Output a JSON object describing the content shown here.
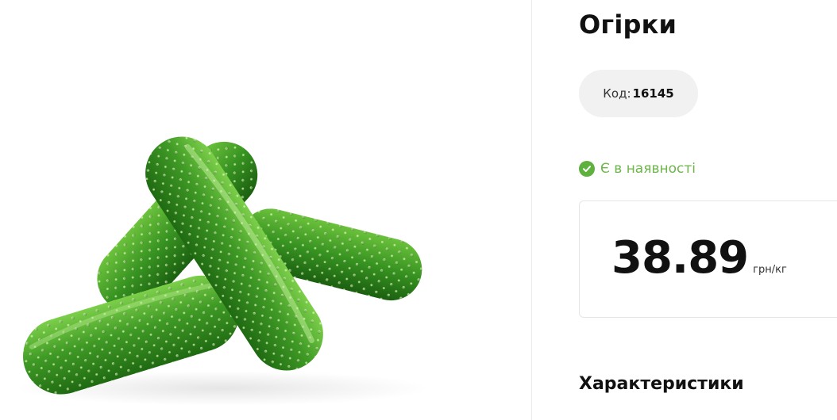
{
  "product": {
    "title": "Огірки",
    "code_label": "Код:",
    "code_value": "16145",
    "availability": "Є в наявності",
    "price": "38.89",
    "price_unit": "грн/кг",
    "characteristics_heading": "Характеристики",
    "image_subject": "cucumbers"
  },
  "colors": {
    "availability_green": "#6cb64a",
    "code_pill_background": "#f1f1f1",
    "cucumber_green": "#3f9a25"
  },
  "icons": {
    "availability": "check-circle-icon"
  }
}
